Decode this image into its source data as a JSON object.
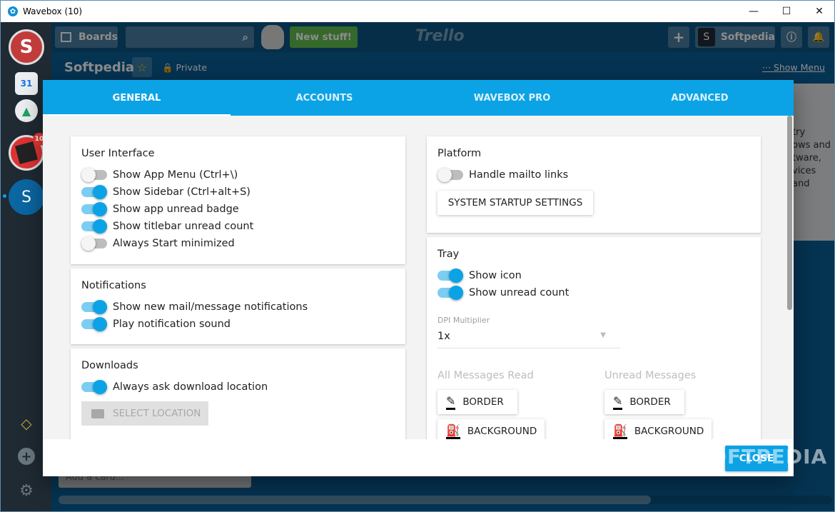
{
  "window": {
    "title": "Wavebox (10)"
  },
  "sidebar": {
    "icons": [
      "mail-icon",
      "calendar-icon",
      "drive-icon",
      "office-icon",
      "account-icon"
    ],
    "calendar_day": "31",
    "office_badge": "10",
    "account_letter": "S"
  },
  "trello": {
    "boards_label": "Boards",
    "new_stuff": "New stuff!",
    "logo": "Trello",
    "user_letter": "S",
    "user_name": "Softpedia",
    "board_title": "Softpedia",
    "privacy": "Private",
    "show_menu": "Show Menu",
    "add_card": "Add a card...",
    "bg_text": [
      "try",
      "ows and",
      "tware,",
      "vices and"
    ]
  },
  "dialog": {
    "tabs": [
      {
        "label": "GENERAL",
        "active": true
      },
      {
        "label": "ACCOUNTS",
        "active": false
      },
      {
        "label": "WAVEBOX PRO",
        "active": false
      },
      {
        "label": "ADVANCED",
        "active": false
      }
    ],
    "ui": {
      "title": "User Interface",
      "items": [
        {
          "label": "Show App Menu (Ctrl+\\)",
          "on": false
        },
        {
          "label": "Show Sidebar (Ctrl+alt+S)",
          "on": true
        },
        {
          "label": "Show app unread badge",
          "on": true
        },
        {
          "label": "Show titlebar unread count",
          "on": true
        },
        {
          "label": "Always Start minimized",
          "on": false
        }
      ]
    },
    "notifications": {
      "title": "Notifications",
      "items": [
        {
          "label": "Show new mail/message notifications",
          "on": true
        },
        {
          "label": "Play notification sound",
          "on": true
        }
      ]
    },
    "downloads": {
      "title": "Downloads",
      "items": [
        {
          "label": "Always ask download location",
          "on": true
        }
      ],
      "select_location": "SELECT LOCATION"
    },
    "platform": {
      "title": "Platform",
      "items": [
        {
          "label": "Handle mailto links",
          "on": false
        }
      ],
      "startup_button": "SYSTEM STARTUP SETTINGS"
    },
    "tray": {
      "title": "Tray",
      "items": [
        {
          "label": "Show icon",
          "on": true
        },
        {
          "label": "Show unread count",
          "on": true
        }
      ],
      "dpi_label": "DPI Multiplier",
      "dpi_value": "1x",
      "all_read_label": "All Messages Read",
      "unread_label": "Unread Messages",
      "border_label": "BORDER",
      "background_label": "BACKGROUND"
    },
    "close_label": "CLOSE"
  },
  "watermark": "SOFTPEDIA",
  "colors": {
    "accent": "#0ba3e6",
    "sidebar": "#1f2a33",
    "trello": "#0a5e96"
  }
}
